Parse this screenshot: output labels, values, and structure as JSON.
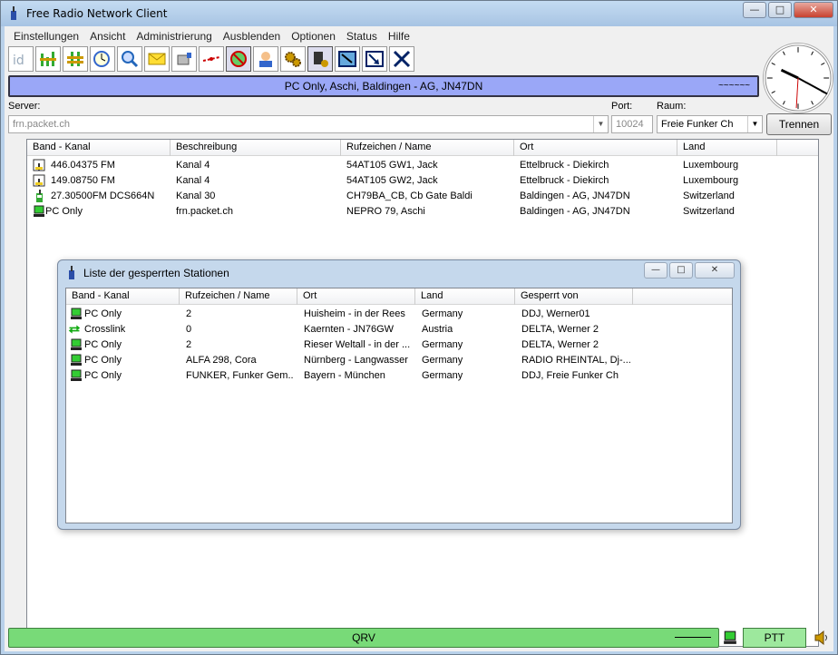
{
  "window": {
    "title": "Free Radio Network Client"
  },
  "menu": [
    "Einstellungen",
    "Ansicht",
    "Administrierung",
    "Ausblenden",
    "Optionen",
    "Status",
    "Hilfe"
  ],
  "toolbar_icons": [
    "id-icon",
    "bars-icon",
    "level-icon",
    "clock-icon",
    "search-icon",
    "mail-icon",
    "hand-icon",
    "link-icon",
    "no-icon",
    "user-icon",
    "gears-icon",
    "station-icon",
    "map-icon",
    "arrow-icon",
    "cross-icon"
  ],
  "banner": {
    "text": "PC Only, Aschi, Baldingen - AG, JN47DN",
    "wave": "~~~~~~"
  },
  "server": {
    "label": "Server:",
    "value": "frn.packet.ch"
  },
  "port": {
    "label": "Port:",
    "value": "10024"
  },
  "room": {
    "label": "Raum:",
    "value": "Freie Funker Ch"
  },
  "disconnect_label": "Trennen",
  "main_list": {
    "columns": [
      "Band - Kanal",
      "Beschreibung",
      "Rufzeichen / Name",
      "Ort",
      "Land"
    ],
    "rows": [
      {
        "icon": "radio-icon",
        "band": "446.04375 FM",
        "desc": "Kanal 4",
        "call": "54AT105 GW1, Jack",
        "ort": "Ettelbruck - Diekirch",
        "land": "Luxembourg"
      },
      {
        "icon": "radio-icon",
        "band": "149.08750 FM",
        "desc": "Kanal 4",
        "call": "54AT105 GW2, Jack",
        "ort": "Ettelbruck - Diekirch",
        "land": "Luxembourg"
      },
      {
        "icon": "handheld-icon",
        "band": "27.30500FM DCS664N",
        "desc": "Kanal 30",
        "call": "CH79BA_CB, Cb Gate Baldi",
        "ort": "Baldingen - AG, JN47DN",
        "land": "Switzerland"
      },
      {
        "icon": "pc-icon",
        "band": "PC Only",
        "desc": "frn.packet.ch",
        "call": "NEPRO 79, Aschi",
        "ort": "Baldingen - AG, JN47DN",
        "land": "Switzerland"
      }
    ]
  },
  "dialog": {
    "title": "Liste der gesperrten Stationen",
    "columns": [
      "Band - Kanal",
      "Rufzeichen / Name",
      "Ort",
      "Land",
      "Gesperrt von"
    ],
    "rows": [
      {
        "icon": "pc-icon",
        "band": "PC Only",
        "call": "2",
        "ort": "Huisheim - in der Rees",
        "land": "Germany",
        "by": "DDJ, Werner01"
      },
      {
        "icon": "crosslink-icon",
        "band": "Crosslink",
        "call": "0",
        "ort": "Kaernten - JN76GW",
        "land": "Austria",
        "by": "DELTA, Werner 2"
      },
      {
        "icon": "pc-icon",
        "band": "PC Only",
        "call": "2",
        "ort": "Rieser Weltall - in der ...",
        "land": "Germany",
        "by": "DELTA, Werner 2"
      },
      {
        "icon": "pc-icon",
        "band": "PC Only",
        "call": "ALFA 298, Cora",
        "ort": "Nürnberg - Langwasser",
        "land": "Germany",
        "by": "RADIO RHEINTAL, Dj-..."
      },
      {
        "icon": "pc-icon",
        "band": "PC Only",
        "call": "FUNKER, Funker Gem...",
        "ort": "Bayern - München",
        "land": "Germany",
        "by": "DDJ, Freie Funker Ch"
      }
    ]
  },
  "status": {
    "text": "QRV",
    "ptt": "PTT"
  },
  "colors": {
    "banner": "#9aa7f7",
    "status": "#78da78",
    "window": "#b9d1ea"
  }
}
